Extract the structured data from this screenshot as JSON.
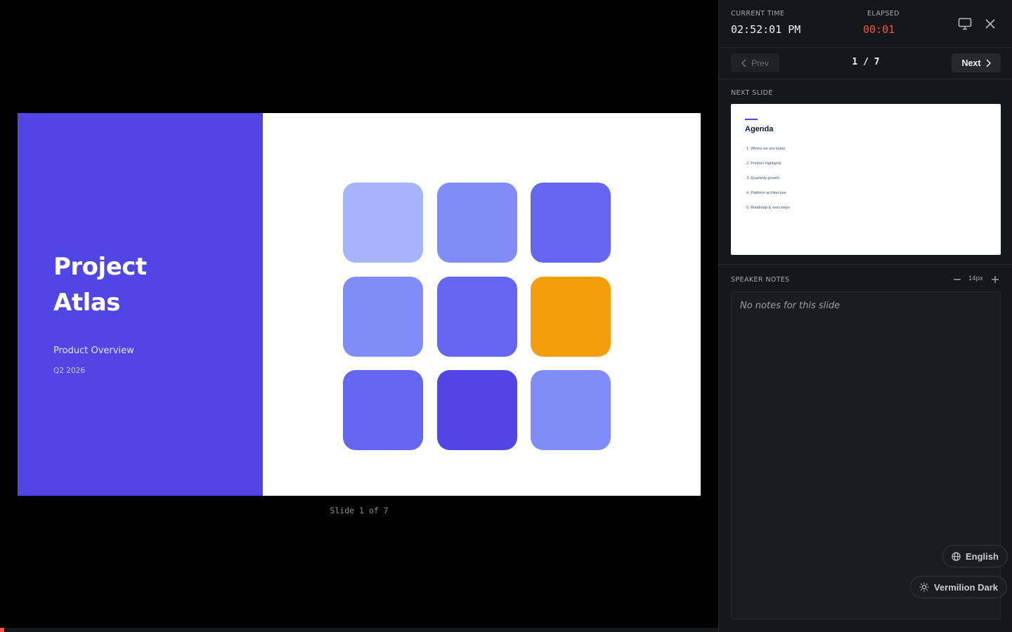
{
  "slide": {
    "title_line1": "Project",
    "title_line2": "Atlas",
    "subtitle": "Product Overview",
    "date": "Q2 2026",
    "caption": "Slide 1 of 7",
    "tile_colors": [
      "#a5b4fc",
      "#818cf8",
      "#6366f1",
      "#818cf8",
      "#6366f1",
      "#f59e0b",
      "#6366f1",
      "#4f46e5",
      "#818cf8"
    ],
    "left_color": "#4f46e5"
  },
  "header": {
    "current_time_label": "CURRENT TIME",
    "current_time": "02:52:01 PM",
    "elapsed_label": "ELAPSED",
    "elapsed": "00:01"
  },
  "nav": {
    "prev_label": "Prev",
    "next_label": "Next",
    "counter": "1 / 7"
  },
  "next_slide": {
    "label": "NEXT SLIDE",
    "title": "Agenda",
    "items": [
      "1.  Where we are today",
      "2.  Product highlights",
      "3.  Quarterly growth",
      "4.  Platform architecture",
      "5.  Roadmap & next steps"
    ]
  },
  "notes": {
    "label": "SPEAKER NOTES",
    "font_size": "14px",
    "text": "No notes for this slide"
  },
  "language": "English",
  "theme": "Vermilion Dark",
  "progress": {
    "fraction": 0.0057,
    "color": "#f0573c"
  }
}
